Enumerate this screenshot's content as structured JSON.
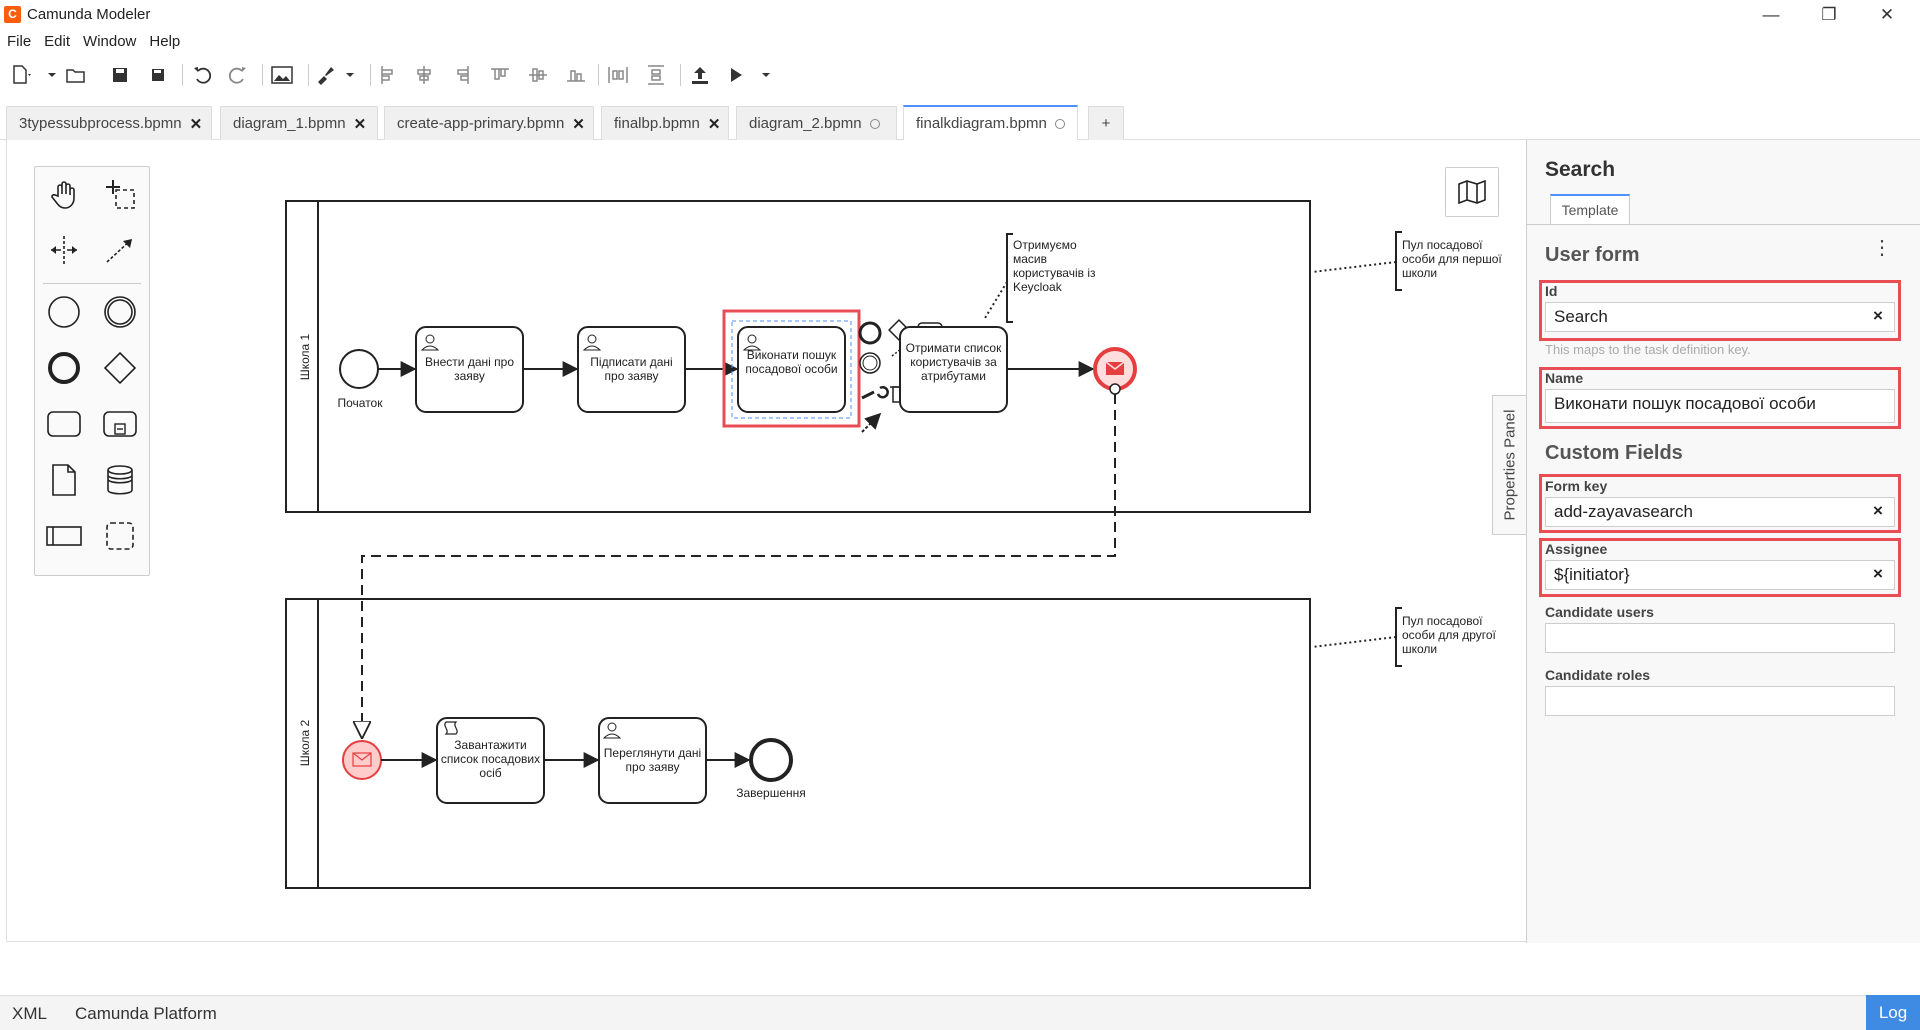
{
  "window": {
    "title": "Camunda Modeler",
    "controls": {
      "minimize": "—",
      "maximize": "❐",
      "close": "✕"
    }
  },
  "menu": {
    "items": [
      "File",
      "Edit",
      "Window",
      "Help"
    ]
  },
  "tabs": [
    {
      "label": "3typessubprocess.bpmn",
      "state": "close"
    },
    {
      "label": "diagram_1.bpmn",
      "state": "close"
    },
    {
      "label": "create-app-primary.bpmn",
      "state": "close"
    },
    {
      "label": "finalbp.bpmn",
      "state": "close"
    },
    {
      "label": "diagram_2.bpmn",
      "state": "dirty"
    },
    {
      "label": "finalkdiagram.bpmn",
      "state": "dirty",
      "active": true
    }
  ],
  "add_tab_label": "+",
  "diagram": {
    "lanes": [
      {
        "label": "Школа 1"
      },
      {
        "label": "Школа 2"
      }
    ],
    "lane1": {
      "start_event": "Початок",
      "task1": "Внести дані про заяву",
      "task2": "Підписати дані про заяву",
      "task3": "Виконати пошук посадової особи",
      "task4": "Отримати список користувачів за атрибутами",
      "annotation": "Отримуємо масив користувачів із Keycloak",
      "pool_note": "Пул посадової особи для першої школи"
    },
    "lane2": {
      "task1": "Завантажити список посадових осіб",
      "task2": "Переглянути дані про заяву",
      "end_event": "Завершення",
      "pool_note": "Пул посадової особи для другої школи"
    }
  },
  "properties": {
    "panel_toggle_label": "Properties Panel",
    "title": "Search",
    "tab": "Template",
    "group1": "User form",
    "id_label": "Id",
    "id_value": "Search",
    "id_description": "This maps to the task definition key.",
    "name_label": "Name",
    "name_value": "Виконати пошук посадової особи",
    "group2": "Custom Fields",
    "form_key_label": "Form key",
    "form_key_value": "add-zayavasearch",
    "assignee_label": "Assignee",
    "assignee_value": "${initiator}",
    "candidate_users_label": "Candidate users",
    "candidate_users_value": "",
    "candidate_roles_label": "Candidate roles",
    "candidate_roles_value": "",
    "clear_glyph": "×",
    "menu_glyph": "⋮"
  },
  "statusbar": {
    "xml": "XML",
    "platform": "Camunda Platform",
    "log": "Log"
  },
  "colors": {
    "accent": "#4d90fe",
    "highlight": "#e84c55",
    "message_event": "#e53e3e",
    "log_button": "#3f8ae2"
  }
}
